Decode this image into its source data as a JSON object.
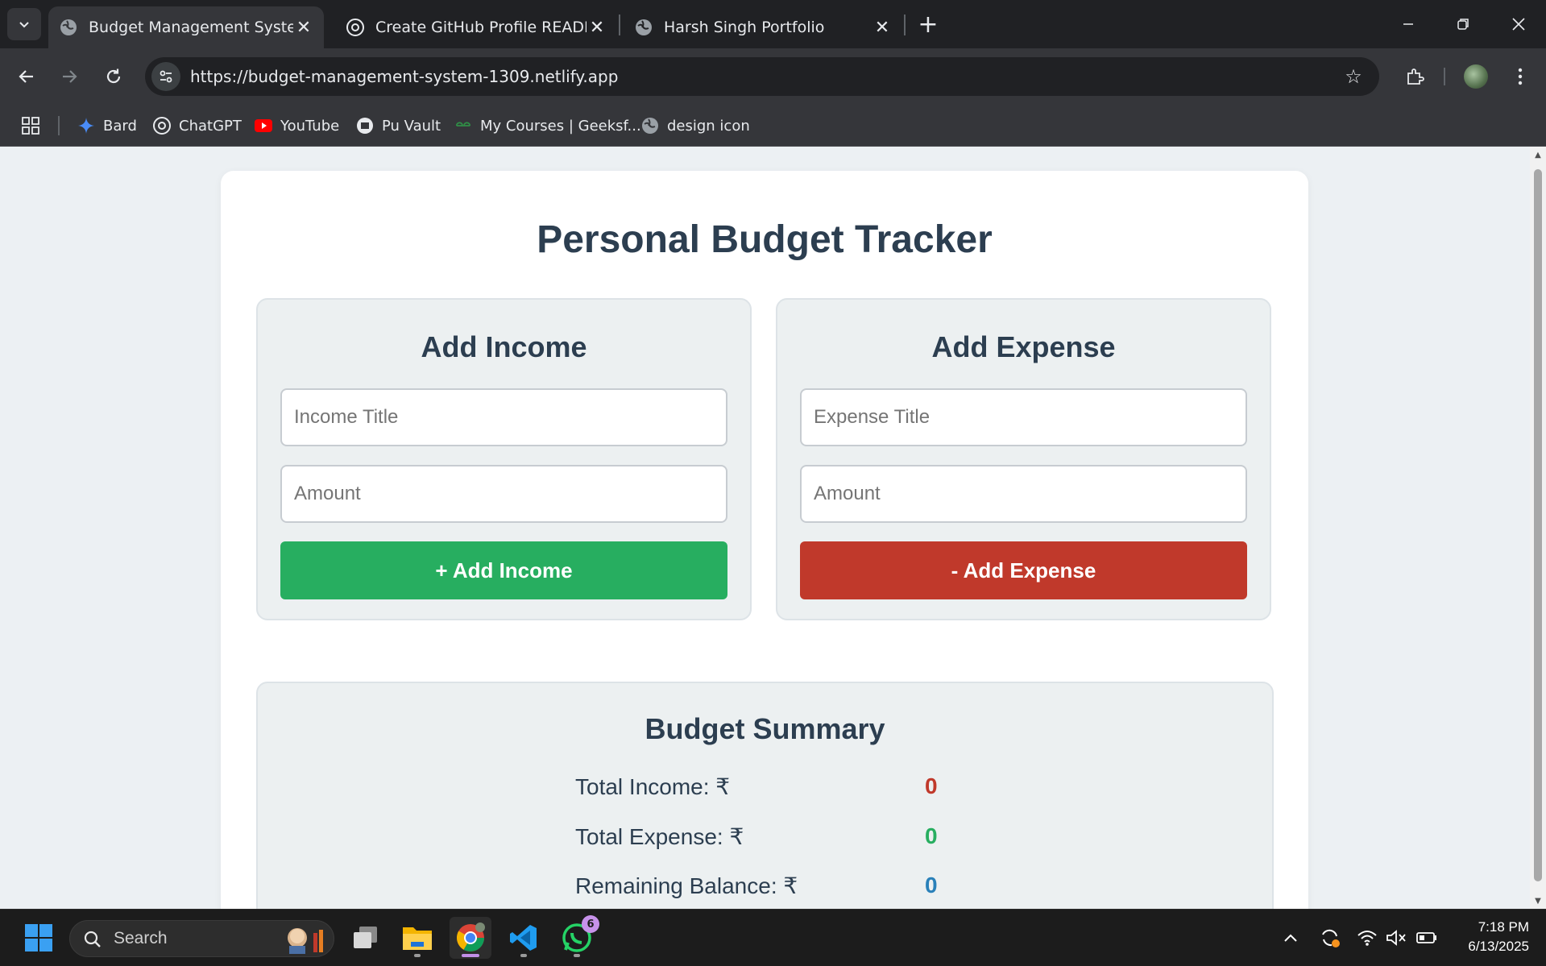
{
  "browser": {
    "tabs": [
      {
        "title": "Budget Management System",
        "active": true
      },
      {
        "title": "Create GitHub Profile README",
        "active": false
      },
      {
        "title": "Harsh Singh Portfolio",
        "active": false
      }
    ],
    "url": "https://budget-management-system-1309.netlify.app",
    "bookmarks": [
      {
        "label": "Bard",
        "icon": "bard-icon"
      },
      {
        "label": "ChatGPT",
        "icon": "chatgpt-icon"
      },
      {
        "label": "YouTube",
        "icon": "youtube-icon"
      },
      {
        "label": "Pu Vault",
        "icon": "pu-vault-icon"
      },
      {
        "label": "My Courses | Geeksf...",
        "icon": "geeksforgeeks-icon"
      },
      {
        "label": "design icon",
        "icon": "globe-icon"
      }
    ]
  },
  "app": {
    "title": "Personal Budget Tracker",
    "income": {
      "heading": "Add Income",
      "title_placeholder": "Income Title",
      "amount_placeholder": "Amount",
      "button": "+ Add Income"
    },
    "expense": {
      "heading": "Add Expense",
      "title_placeholder": "Expense Title",
      "amount_placeholder": "Amount",
      "button": "- Add Expense"
    },
    "summary": {
      "heading": "Budget Summary",
      "total_income_label": "Total Income: ₹",
      "total_income_value": "0",
      "total_expense_label": "Total Expense: ₹",
      "total_expense_value": "0",
      "balance_label": "Remaining Balance: ₹",
      "balance_value": "0"
    }
  },
  "taskbar": {
    "search_label": "Search",
    "whatsapp_badge": "6",
    "time": "7:18 PM",
    "date": "6/13/2025"
  },
  "colors": {
    "income_green": "#27ae60",
    "expense_red": "#c0392b",
    "balance_blue": "#2980b9",
    "heading_navy": "#2c3e50"
  }
}
